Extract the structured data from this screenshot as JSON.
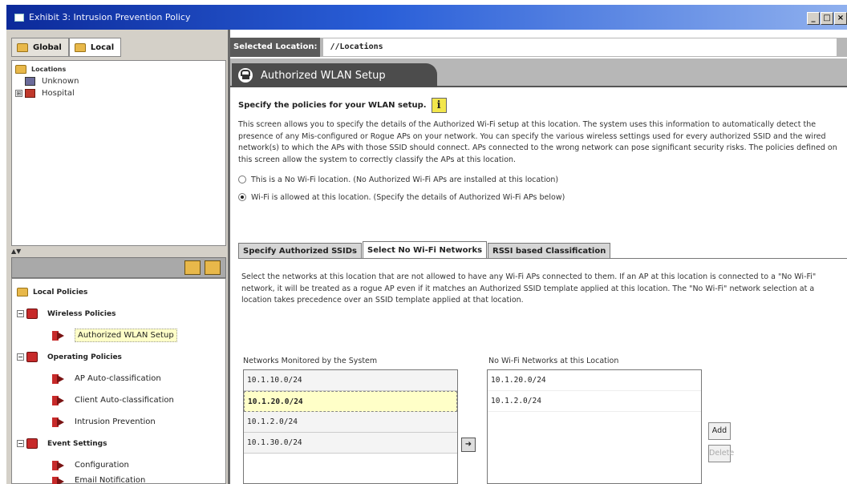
{
  "window": {
    "title": "Exhibit 3: Intrusion Prevention Policy",
    "controls": [
      "_",
      "□",
      "×"
    ]
  },
  "scope_tabs": [
    {
      "label": "Global"
    },
    {
      "label": "Local"
    }
  ],
  "location_tree": {
    "root": "Locations",
    "items": [
      {
        "label": "Unknown"
      },
      {
        "label": "Hospital",
        "expander": "⊞"
      }
    ]
  },
  "policy_tree": {
    "root": "Local Policies",
    "groups": [
      {
        "label": "Wireless Policies",
        "children": [
          "Authorized WLAN Setup"
        ]
      },
      {
        "label": "Operating Policies",
        "children": [
          "AP Auto-classification",
          "Client Auto-classification",
          "Intrusion Prevention"
        ]
      },
      {
        "label": "Event Settings",
        "children": [
          "Configuration",
          "Email Notification"
        ]
      }
    ],
    "selected": "Authorized WLAN Setup"
  },
  "location_bar": {
    "label": "Selected Location:",
    "value": "//Locations"
  },
  "page_tab": {
    "label": "Authorized WLAN Setup"
  },
  "main": {
    "heading": "Specify the policies for your WLAN setup.",
    "info_glyph": "i",
    "description": "This screen allows you to specify the details of the Authorized Wi-Fi setup at this location. The system uses this information to automatically detect the presence of any Mis-configured or Rogue APs on your network. You can specify the various wireless settings used for every authorized SSID and the wired network(s) to which the APs with those SSID should connect. APs connected to the wrong network can pose significant security risks. The policies defined on this screen allow the system to correctly classify the APs at this location.",
    "radio_no_wifi": "This is a No Wi-Fi location. (No Authorized Wi-Fi APs are installed at this location)",
    "radio_wifi_allowed": "Wi-Fi is allowed at this location. (Specify the details of Authorized Wi-Fi APs below)"
  },
  "sub_tabs": [
    {
      "label": "Specify Authorized SSIDs"
    },
    {
      "label": "Select No Wi-Fi Networks"
    },
    {
      "label": "RSSI based Classification"
    }
  ],
  "no_wifi": {
    "description": "Select the networks at this location that are not allowed to have any Wi-Fi APs connected to them. If an AP at this location is connected to a \"No Wi-Fi\" network, it will be treated as a rogue AP even if it matches an Authorized SSID template applied at this location. The \"No Wi-Fi\" network selection at a location takes precedence over an SSID template applied at that location.",
    "monitored_header": "Networks Monitored by the System",
    "monitored": [
      "10.1.10.0/24",
      "10.1.20.0/24",
      "10.1.2.0/24",
      "10.1.30.0/24"
    ],
    "selected_header": "No Wi-Fi Networks at this Location",
    "selected": [
      "10.1.20.0/24",
      "10.1.2.0/24"
    ],
    "move_glyph": "➜",
    "add_label": "Add",
    "delete_label": "Delete"
  },
  "colors": {
    "title_start": "#0c2a9a",
    "title_end": "#8fb0ee",
    "selection": "#ffffc8",
    "policy_icon": "#c72a2a"
  }
}
